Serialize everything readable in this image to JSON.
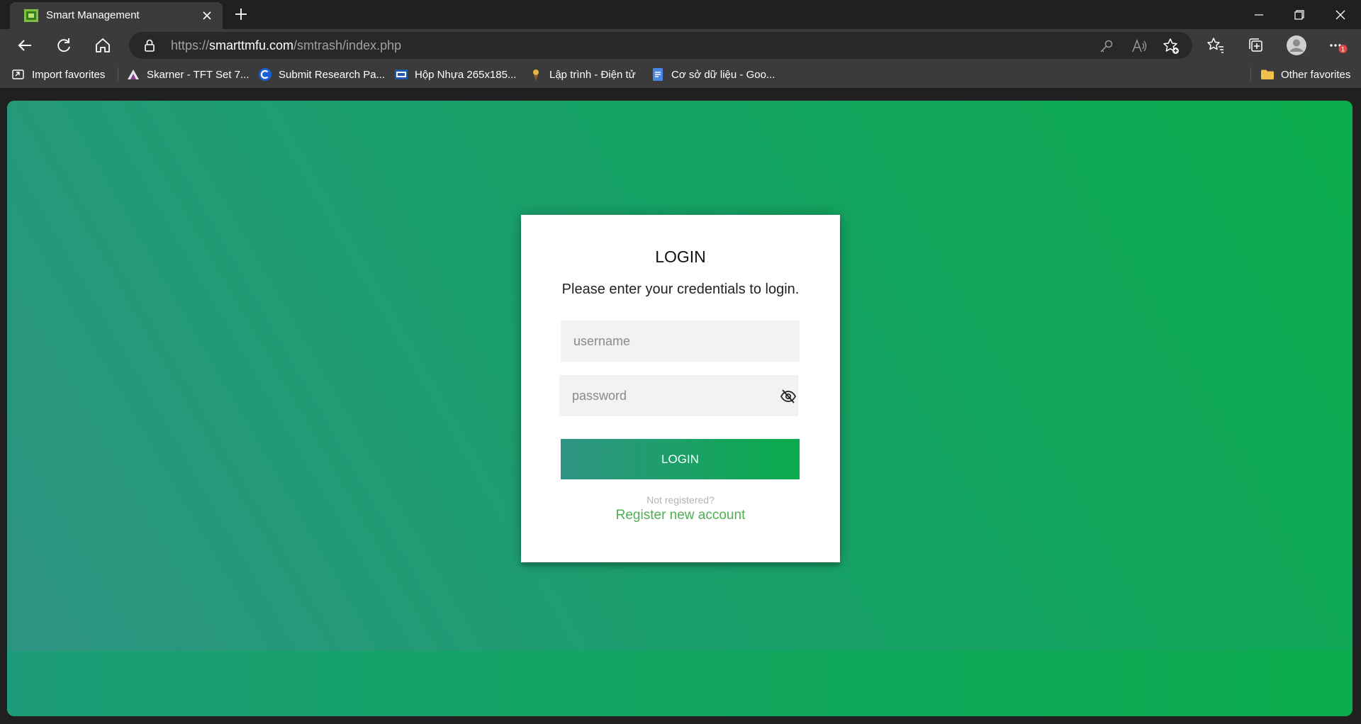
{
  "browser": {
    "tab_title": "Smart Management",
    "url_prefix": "https://",
    "url_host": "smarttmfu.com",
    "url_path": "/smtrash/index.php",
    "favorites": [
      {
        "label": "Import favorites",
        "icon": "import-icon"
      },
      {
        "label": "Skarner - TFT Set 7...",
        "icon": "skarner-favicon"
      },
      {
        "label": "Submit Research Pa...",
        "icon": "c-favicon"
      },
      {
        "label": "Hộp Nhựa 265x185...",
        "icon": "hop-nhua-favicon"
      },
      {
        "label": "Lập trình - Điện tử",
        "icon": "lap-trinh-favicon"
      },
      {
        "label": "Cơ sở dữ liệu - Goo...",
        "icon": "google-docs-favicon"
      }
    ],
    "other_favorites": "Other favorites",
    "notification_badge": "1"
  },
  "login": {
    "title": "LOGIN",
    "subtitle": "Please enter your credentials to login.",
    "username_placeholder": "username",
    "password_placeholder": "password",
    "button_label": "LOGIN",
    "not_registered": "Not registered?",
    "register_link": "Register new account"
  },
  "colors": {
    "gradient_start": "#2e9384",
    "gradient_end": "#0aac4c",
    "link": "#4caf50"
  }
}
